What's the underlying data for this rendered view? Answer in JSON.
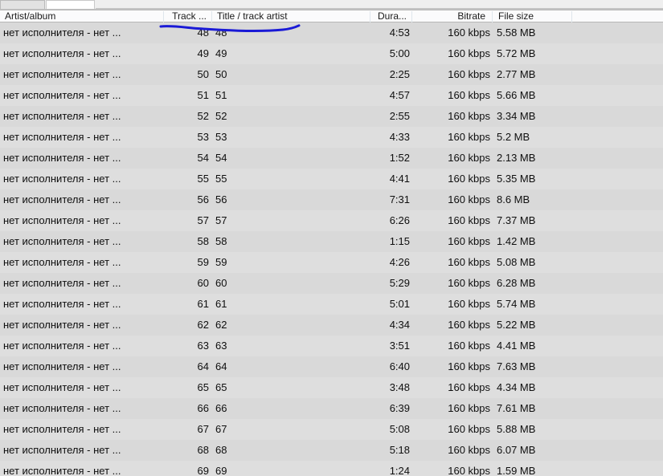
{
  "window": {
    "title": "Media library — playlist view"
  },
  "tabs": [
    {
      "label": "",
      "state": "inactive",
      "x": 0,
      "width": 56
    },
    {
      "label": "",
      "state": "active",
      "x": 57,
      "width": 61
    }
  ],
  "columns": [
    {
      "key": "artist",
      "label": "Artist/album",
      "align": "left"
    },
    {
      "key": "track",
      "label": "Track ...",
      "align": "right"
    },
    {
      "key": "title",
      "label": "Title / track artist",
      "align": "left"
    },
    {
      "key": "duration",
      "label": "Dura...",
      "align": "right"
    },
    {
      "key": "bitrate",
      "label": "Bitrate",
      "align": "right"
    },
    {
      "key": "filesize",
      "label": "File size",
      "align": "left"
    }
  ],
  "rows": [
    {
      "artist": "нет исполнителя - нет ...",
      "track": "48",
      "title": "48",
      "duration": "4:53",
      "bitrate": "160 kbps",
      "filesize": "5.58 MB"
    },
    {
      "artist": "нет исполнителя - нет ...",
      "track": "49",
      "title": "49",
      "duration": "5:00",
      "bitrate": "160 kbps",
      "filesize": "5.72 MB"
    },
    {
      "artist": "нет исполнителя - нет ...",
      "track": "50",
      "title": "50",
      "duration": "2:25",
      "bitrate": "160 kbps",
      "filesize": "2.77 MB"
    },
    {
      "artist": "нет исполнителя - нет ...",
      "track": "51",
      "title": "51",
      "duration": "4:57",
      "bitrate": "160 kbps",
      "filesize": "5.66 MB"
    },
    {
      "artist": "нет исполнителя - нет ...",
      "track": "52",
      "title": "52",
      "duration": "2:55",
      "bitrate": "160 kbps",
      "filesize": "3.34 MB"
    },
    {
      "artist": "нет исполнителя - нет ...",
      "track": "53",
      "title": "53",
      "duration": "4:33",
      "bitrate": "160 kbps",
      "filesize": "5.2 MB"
    },
    {
      "artist": "нет исполнителя - нет ...",
      "track": "54",
      "title": "54",
      "duration": "1:52",
      "bitrate": "160 kbps",
      "filesize": "2.13 MB"
    },
    {
      "artist": "нет исполнителя - нет ...",
      "track": "55",
      "title": "55",
      "duration": "4:41",
      "bitrate": "160 kbps",
      "filesize": "5.35 MB"
    },
    {
      "artist": "нет исполнителя - нет ...",
      "track": "56",
      "title": "56",
      "duration": "7:31",
      "bitrate": "160 kbps",
      "filesize": "8.6 MB"
    },
    {
      "artist": "нет исполнителя - нет ...",
      "track": "57",
      "title": "57",
      "duration": "6:26",
      "bitrate": "160 kbps",
      "filesize": "7.37 MB"
    },
    {
      "artist": "нет исполнителя - нет ...",
      "track": "58",
      "title": "58",
      "duration": "1:15",
      "bitrate": "160 kbps",
      "filesize": "1.42 MB"
    },
    {
      "artist": "нет исполнителя - нет ...",
      "track": "59",
      "title": "59",
      "duration": "4:26",
      "bitrate": "160 kbps",
      "filesize": "5.08 MB"
    },
    {
      "artist": "нет исполнителя - нет ...",
      "track": "60",
      "title": "60",
      "duration": "5:29",
      "bitrate": "160 kbps",
      "filesize": "6.28 MB"
    },
    {
      "artist": "нет исполнителя - нет ...",
      "track": "61",
      "title": "61",
      "duration": "5:01",
      "bitrate": "160 kbps",
      "filesize": "5.74 MB"
    },
    {
      "artist": "нет исполнителя - нет ...",
      "track": "62",
      "title": "62",
      "duration": "4:34",
      "bitrate": "160 kbps",
      "filesize": "5.22 MB"
    },
    {
      "artist": "нет исполнителя - нет ...",
      "track": "63",
      "title": "63",
      "duration": "3:51",
      "bitrate": "160 kbps",
      "filesize": "4.41 MB"
    },
    {
      "artist": "нет исполнителя - нет ...",
      "track": "64",
      "title": "64",
      "duration": "6:40",
      "bitrate": "160 kbps",
      "filesize": "7.63 MB"
    },
    {
      "artist": "нет исполнителя - нет ...",
      "track": "65",
      "title": "65",
      "duration": "3:48",
      "bitrate": "160 kbps",
      "filesize": "4.34 MB"
    },
    {
      "artist": "нет исполнителя - нет ...",
      "track": "66",
      "title": "66",
      "duration": "6:39",
      "bitrate": "160 kbps",
      "filesize": "7.61 MB"
    },
    {
      "artist": "нет исполнителя - нет ...",
      "track": "67",
      "title": "67",
      "duration": "5:08",
      "bitrate": "160 kbps",
      "filesize": "5.88 MB"
    },
    {
      "artist": "нет исполнителя - нет ...",
      "track": "68",
      "title": "68",
      "duration": "5:18",
      "bitrate": "160 kbps",
      "filesize": "6.07 MB"
    },
    {
      "artist": "нет исполнителя - нет ...",
      "track": "69",
      "title": "69",
      "duration": "1:24",
      "bitrate": "160 kbps",
      "filesize": "1.59 MB"
    }
  ],
  "annotation": {
    "kind": "freehand-underline",
    "color": "#1a1ad6",
    "target_row_index": 0,
    "description": "hand drawn blue squiggle underlining the first row track/title area"
  },
  "colors": {
    "header_background": "#fbfbfc",
    "row_odd": "#d9d9d9",
    "row_even": "#dedede",
    "tab_active": "#ffffff",
    "tab_inactive": "#e2e2e2",
    "text": "#0f0f0f",
    "annotation_blue": "#1a1ad6"
  }
}
